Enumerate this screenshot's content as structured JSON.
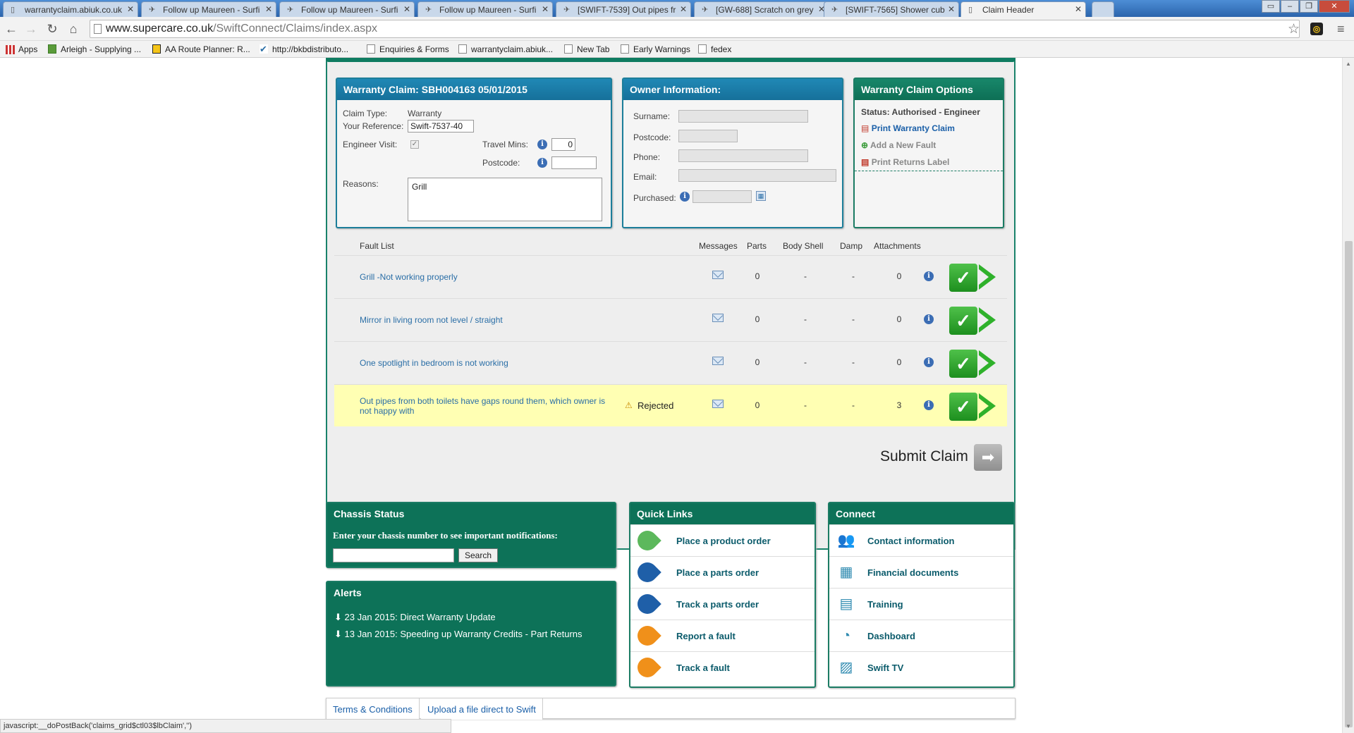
{
  "browser": {
    "tabs": [
      {
        "label": "warrantyclaim.abiuk.co.uk",
        "icon": "page-icon"
      },
      {
        "label": "Follow up Maureen - Surfi",
        "icon": "jira-icon"
      },
      {
        "label": "Follow up Maureen - Surfi",
        "icon": "jira-icon"
      },
      {
        "label": "Follow up Maureen - Surfi",
        "icon": "jira-icon"
      },
      {
        "label": "[SWIFT-7539] Out pipes fr",
        "icon": "jira-icon"
      },
      {
        "label": "[GW-688] Scratch on grey",
        "icon": "jira-icon"
      },
      {
        "label": "[SWIFT-7565] Shower cub",
        "icon": "jira-icon"
      },
      {
        "label": "Claim Header",
        "icon": "page-icon"
      }
    ],
    "url_domain": "www.supercare.co.uk",
    "url_path": "/SwiftConnect/Claims/index.aspx",
    "bookmarks": [
      "Apps",
      "Arleigh - Supplying ...",
      "AA Route Planner: R...",
      "http://bkbdistributo...",
      "Enquiries & Forms",
      "warrantyclaim.abiuk...",
      "New Tab",
      "Early Warnings",
      "fedex"
    ],
    "status_text": "javascript:__doPostBack('claims_grid$ctl03$lbClaim','')"
  },
  "claim": {
    "title": "Warranty Claim: SBH004163 05/01/2015",
    "claim_type_label": "Claim Type:",
    "claim_type_value": "Warranty",
    "reference_label": "Your Reference:",
    "reference_value": "Swift-7537-40",
    "engineer_label": "Engineer Visit:",
    "travel_label": "Travel Mins:",
    "travel_value": "0",
    "postcode_label": "Postcode:",
    "postcode_value": "",
    "reasons_label": "Reasons:",
    "reasons_value": "Grill"
  },
  "owner": {
    "title": "Owner Information:",
    "surname_label": "Surname:",
    "postcode_label": "Postcode:",
    "phone_label": "Phone:",
    "email_label": "Email:",
    "purchased_label": "Purchased:"
  },
  "options": {
    "title": "Warranty Claim Options",
    "status": "Status: Authorised - Engineer",
    "print_claim": "Print Warranty Claim",
    "add_fault": "Add a New Fault",
    "print_label": "Print Returns Label"
  },
  "faults": {
    "headers": {
      "list": "Fault List",
      "messages": "Messages",
      "parts": "Parts",
      "body": "Body Shell",
      "damp": "Damp",
      "attachments": "Attachments"
    },
    "rows": [
      {
        "label": "Grill -Not working properly",
        "status": "",
        "parts": "0",
        "body": "-",
        "damp": "-",
        "attachments": "0"
      },
      {
        "label": "Mirror in living room not level / straight",
        "status": "",
        "parts": "0",
        "body": "-",
        "damp": "-",
        "attachments": "0"
      },
      {
        "label": "One spotlight in bedroom is not working",
        "status": "",
        "parts": "0",
        "body": "-",
        "damp": "-",
        "attachments": "0"
      },
      {
        "label": "Out pipes from both toilets have gaps round them, which owner is not happy with",
        "status": "Rejected",
        "parts": "0",
        "body": "-",
        "damp": "-",
        "attachments": "3"
      }
    ],
    "submit_label": "Submit Claim"
  },
  "chassis": {
    "title": "Chassis Status",
    "prompt": "Enter your chassis number to see important notifications:",
    "search_label": "Search"
  },
  "alerts": {
    "title": "Alerts",
    "items": [
      "23 Jan 2015: Direct Warranty Update",
      "13 Jan 2015: Speeding up Warranty Credits - Part Returns"
    ]
  },
  "quick_links": {
    "title": "Quick Links",
    "items": [
      {
        "label": "Place a product order",
        "color": "#5cb85c"
      },
      {
        "label": "Place a parts order",
        "color": "#1f5fa8"
      },
      {
        "label": "Track a parts order",
        "color": "#1f5fa8"
      },
      {
        "label": "Report a fault",
        "color": "#f0901a"
      },
      {
        "label": "Track a fault",
        "color": "#f0901a"
      }
    ]
  },
  "connect": {
    "title": "Connect",
    "items": [
      {
        "label": "Contact information",
        "icon": "people-icon"
      },
      {
        "label": "Financial documents",
        "icon": "calculator-icon"
      },
      {
        "label": "Training",
        "icon": "calendar-icon"
      },
      {
        "label": "Dashboard",
        "icon": "gauge-icon"
      },
      {
        "label": "Swift TV",
        "icon": "clapper-icon"
      }
    ]
  },
  "footer": {
    "terms": "Terms & Conditions",
    "upload": "Upload a file direct to Swift"
  }
}
